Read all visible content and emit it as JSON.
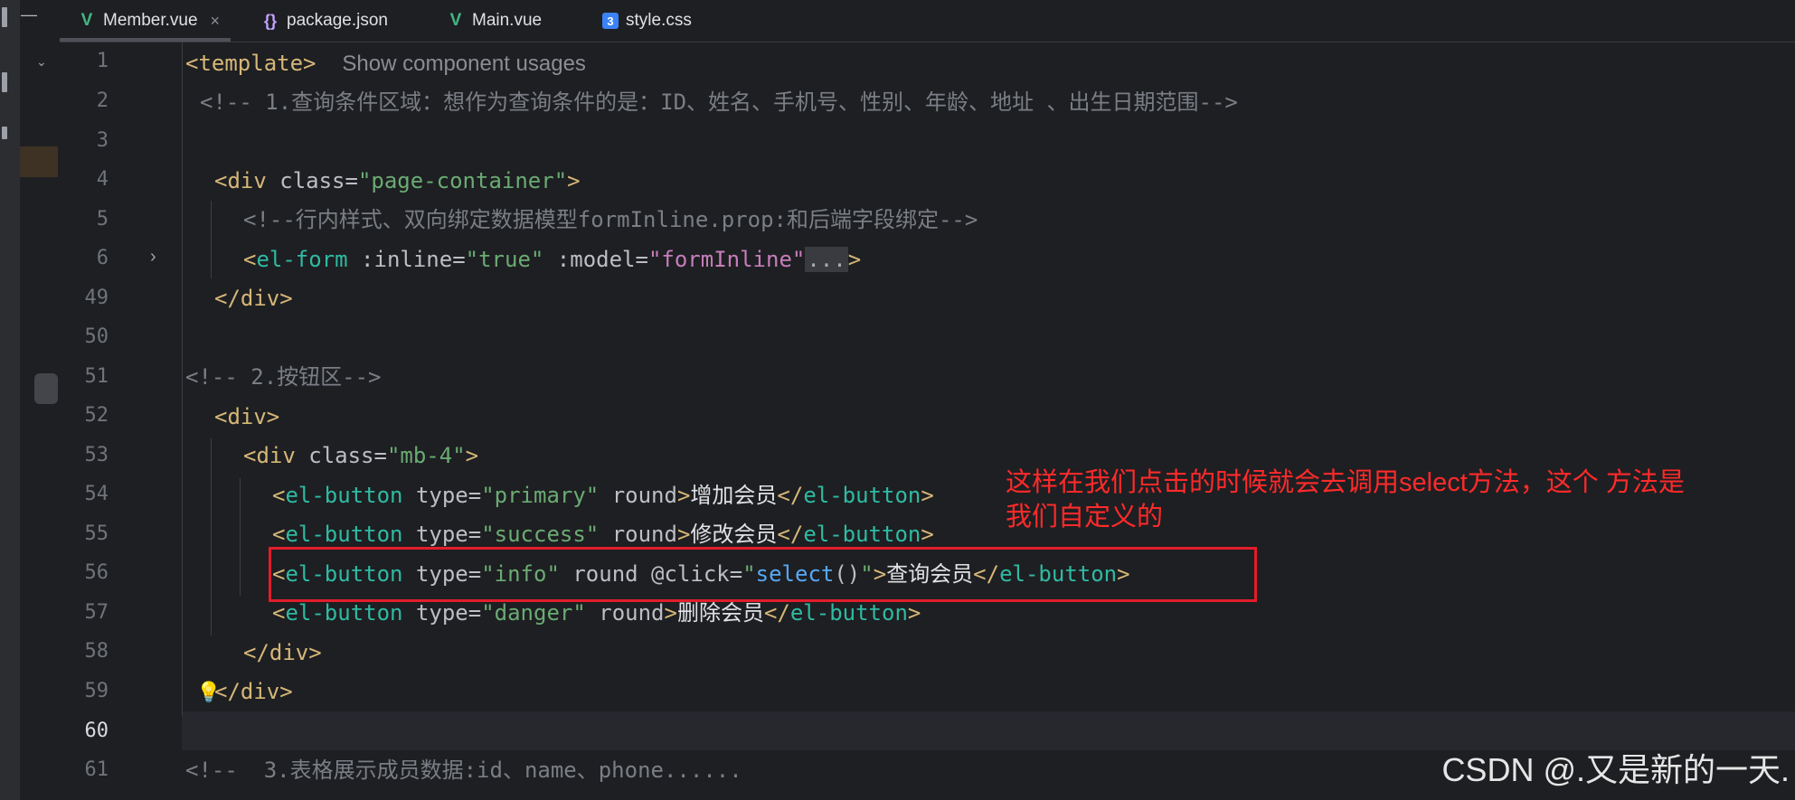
{
  "tabs": [
    {
      "label": "Member.vue",
      "icon": "vue-icon",
      "active": true,
      "close": "×"
    },
    {
      "label": "package.json",
      "icon": "json-icon",
      "active": false
    },
    {
      "label": "Main.vue",
      "icon": "vue-icon",
      "active": false
    },
    {
      "label": "style.css",
      "icon": "css-icon",
      "active": false
    }
  ],
  "line_numbers": [
    "1",
    "2",
    "3",
    "4",
    "5",
    "6",
    "49",
    "50",
    "51",
    "52",
    "53",
    "54",
    "55",
    "56",
    "57",
    "58",
    "59",
    "60",
    "61"
  ],
  "current_line": "60",
  "code": {
    "l1_tag": "<template>",
    "l1_inlay": "Show component usages",
    "l2": "<!-- 1.查询条件区域：想作为查询条件的是：ID、姓名、手机号、性别、年龄、地址 、出生日期范围-->",
    "l4_open": "<div ",
    "l4_attr": "class=",
    "l4_val": "\"page-container\"",
    "l4_close": ">",
    "l5": "<!--行内样式、双向绑定数据模型formInline.prop:和后端字段绑定-->",
    "l6_lt": "<",
    "l6_tag": "el-form",
    "l6_attr1": " :inline=",
    "l6_val1": "\"true\"",
    "l6_attr2": " :model=",
    "l6_val2": "\"formInline\"",
    "l6_dots": "...",
    "l6_gt": ">",
    "l49": "</div>",
    "l51": "<!-- 2.按钮区-->",
    "l52": "<div>",
    "l53_open": "<div ",
    "l53_attr": "class=",
    "l53_val": "\"mb-4\"",
    "l53_close": ">",
    "btn_lt": "<",
    "btn_tag": "el-button",
    "btn_type": " type=",
    "btn_round": " round",
    "btn_gt": ">",
    "btn_end_lt": "</",
    "btn_end_tag": "el-button",
    "btn_end_gt": ">",
    "l54_val": "\"primary\"",
    "l54_text": "增加会员",
    "l55_val": "\"success\"",
    "l55_text": "修改会员",
    "l56_val": "\"info\"",
    "l56_click": " @click=",
    "l56_q1": "\"",
    "l56_fn": "select",
    "l56_paren": "()",
    "l56_q2": "\"",
    "l56_text": "查询会员",
    "l57_val": "\"danger\"",
    "l57_text": "删除会员",
    "l58": "</div>",
    "l59": "</div>",
    "l61": "<!--  3.表格展示成员数据:id、name、phone......"
  },
  "annotation": {
    "line1": "这样在我们点击的时候就会去调用select方法，这个 方法是",
    "line2": "我们自定义的"
  },
  "watermark": "CSDN @.又是新的一天.",
  "colors": {
    "annotation": "#ff2a2a",
    "highlight_box": "#e21d2a",
    "tag": "#d5b778",
    "element": "#2fbaa3",
    "string": "#6aab73"
  }
}
